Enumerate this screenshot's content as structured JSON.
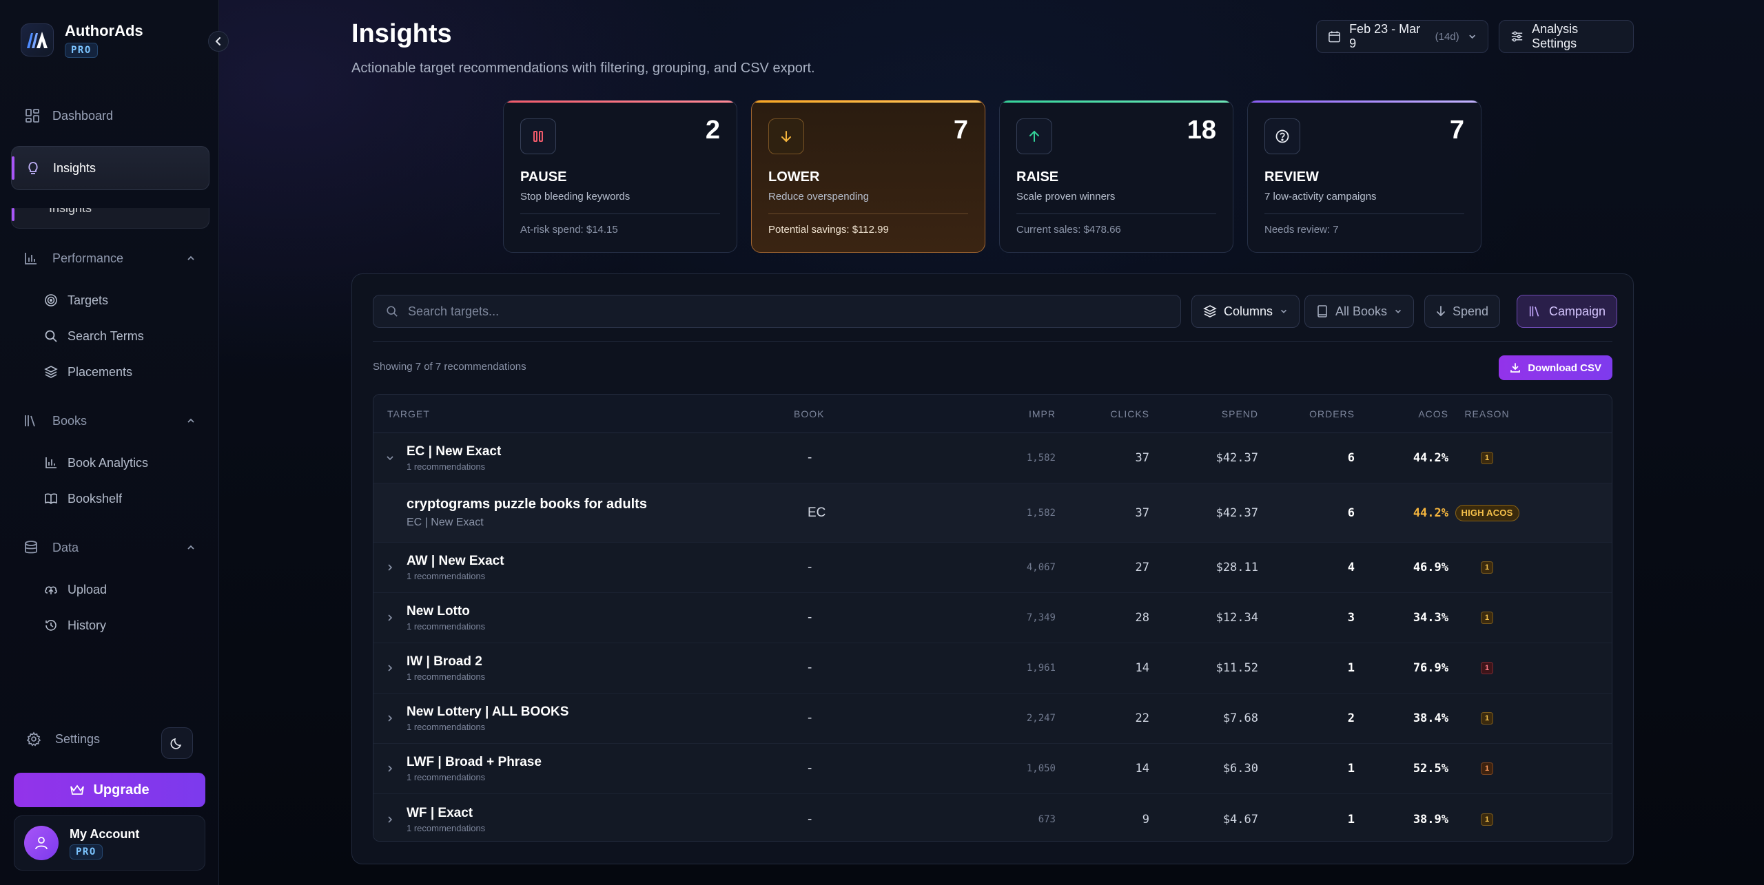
{
  "brand": {
    "name": "AuthorAds",
    "tier": "PRO"
  },
  "nav": {
    "dashboard": "Dashboard",
    "insights": "Insights",
    "performance": "Performance",
    "targets": "Targets",
    "search_terms": "Search Terms",
    "placements": "Placements",
    "books": "Books",
    "book_analytics": "Book Analytics",
    "bookshelf": "Bookshelf",
    "data": "Data",
    "upload": "Upload",
    "history": "History"
  },
  "footer": {
    "settings": "Settings",
    "upgrade": "Upgrade",
    "account_name": "My Account",
    "account_tier": "PRO"
  },
  "header": {
    "title": "Insights",
    "subtitle": "Actionable target recommendations with filtering, grouping, and CSV export.",
    "date_range": "Feb 23 - Mar 9",
    "date_days": "(14d)",
    "analysis_settings": "Analysis Settings"
  },
  "colors": {
    "accent": "#9333ea",
    "pause": "#f05a6a",
    "lower": "#f5a623",
    "raise": "#34d399",
    "review": "#a78bfa"
  },
  "stats": [
    {
      "icon": "pause-icon",
      "count": "2",
      "label": "PAUSE",
      "desc": "Stop bleeding keywords",
      "foot": "At-risk spend: $14.15"
    },
    {
      "icon": "arrow-down-icon",
      "count": "7",
      "label": "LOWER",
      "desc": "Reduce overspending",
      "foot": "Potential savings: $112.99"
    },
    {
      "icon": "arrow-up-icon",
      "count": "18",
      "label": "RAISE",
      "desc": "Scale proven winners",
      "foot": "Current sales: $478.66"
    },
    {
      "icon": "question-icon",
      "count": "7",
      "label": "REVIEW",
      "desc": "7 low-activity campaigns",
      "foot": "Needs review: 7"
    }
  ],
  "toolbar": {
    "search_placeholder": "Search targets...",
    "columns": "Columns",
    "books_filter": "All Books",
    "sort": "Spend",
    "group": "Campaign"
  },
  "showing": "Showing 7 of 7 recommendations",
  "download_csv": "Download CSV",
  "table": {
    "headers": {
      "target": "TARGET",
      "book": "BOOK",
      "impr": "IMPR",
      "clicks": "CLICKS",
      "spend": "SPEND",
      "orders": "ORDERS",
      "acos": "ACOS",
      "reason": "REASON"
    },
    "rows": [
      {
        "name": "EC | New Exact",
        "sub": "1 recommendations",
        "book": "-",
        "impr": "1,582",
        "clicks": "37",
        "spend": "$42.37",
        "orders": "6",
        "acos": "44.2%",
        "reason": "1"
      },
      {
        "name": "cryptograms puzzle books for adults",
        "sub": "EC | New Exact",
        "book": "EC",
        "impr": "1,582",
        "clicks": "37",
        "spend": "$42.37",
        "orders": "6",
        "acos": "44.2%",
        "reason": "HIGH ACOS"
      },
      {
        "name": "AW | New Exact",
        "sub": "1 recommendations",
        "book": "-",
        "impr": "4,067",
        "clicks": "27",
        "spend": "$28.11",
        "orders": "4",
        "acos": "46.9%",
        "reason": "1"
      },
      {
        "name": "New Lotto",
        "sub": "1 recommendations",
        "book": "-",
        "impr": "7,349",
        "clicks": "28",
        "spend": "$12.34",
        "orders": "3",
        "acos": "34.3%",
        "reason": "1"
      },
      {
        "name": "IW | Broad 2",
        "sub": "1 recommendations",
        "book": "-",
        "impr": "1,961",
        "clicks": "14",
        "spend": "$11.52",
        "orders": "1",
        "acos": "76.9%",
        "reason": "1"
      },
      {
        "name": "New Lottery | ALL BOOKS",
        "sub": "1 recommendations",
        "book": "-",
        "impr": "2,247",
        "clicks": "22",
        "spend": "$7.68",
        "orders": "2",
        "acos": "38.4%",
        "reason": "1"
      },
      {
        "name": "LWF | Broad + Phrase",
        "sub": "1 recommendations",
        "book": "-",
        "impr": "1,050",
        "clicks": "14",
        "spend": "$6.30",
        "orders": "1",
        "acos": "52.5%",
        "reason": "1"
      },
      {
        "name": "WF | Exact",
        "sub": "1 recommendations",
        "book": "-",
        "impr": "673",
        "clicks": "9",
        "spend": "$4.67",
        "orders": "1",
        "acos": "38.9%",
        "reason": "1"
      }
    ]
  }
}
